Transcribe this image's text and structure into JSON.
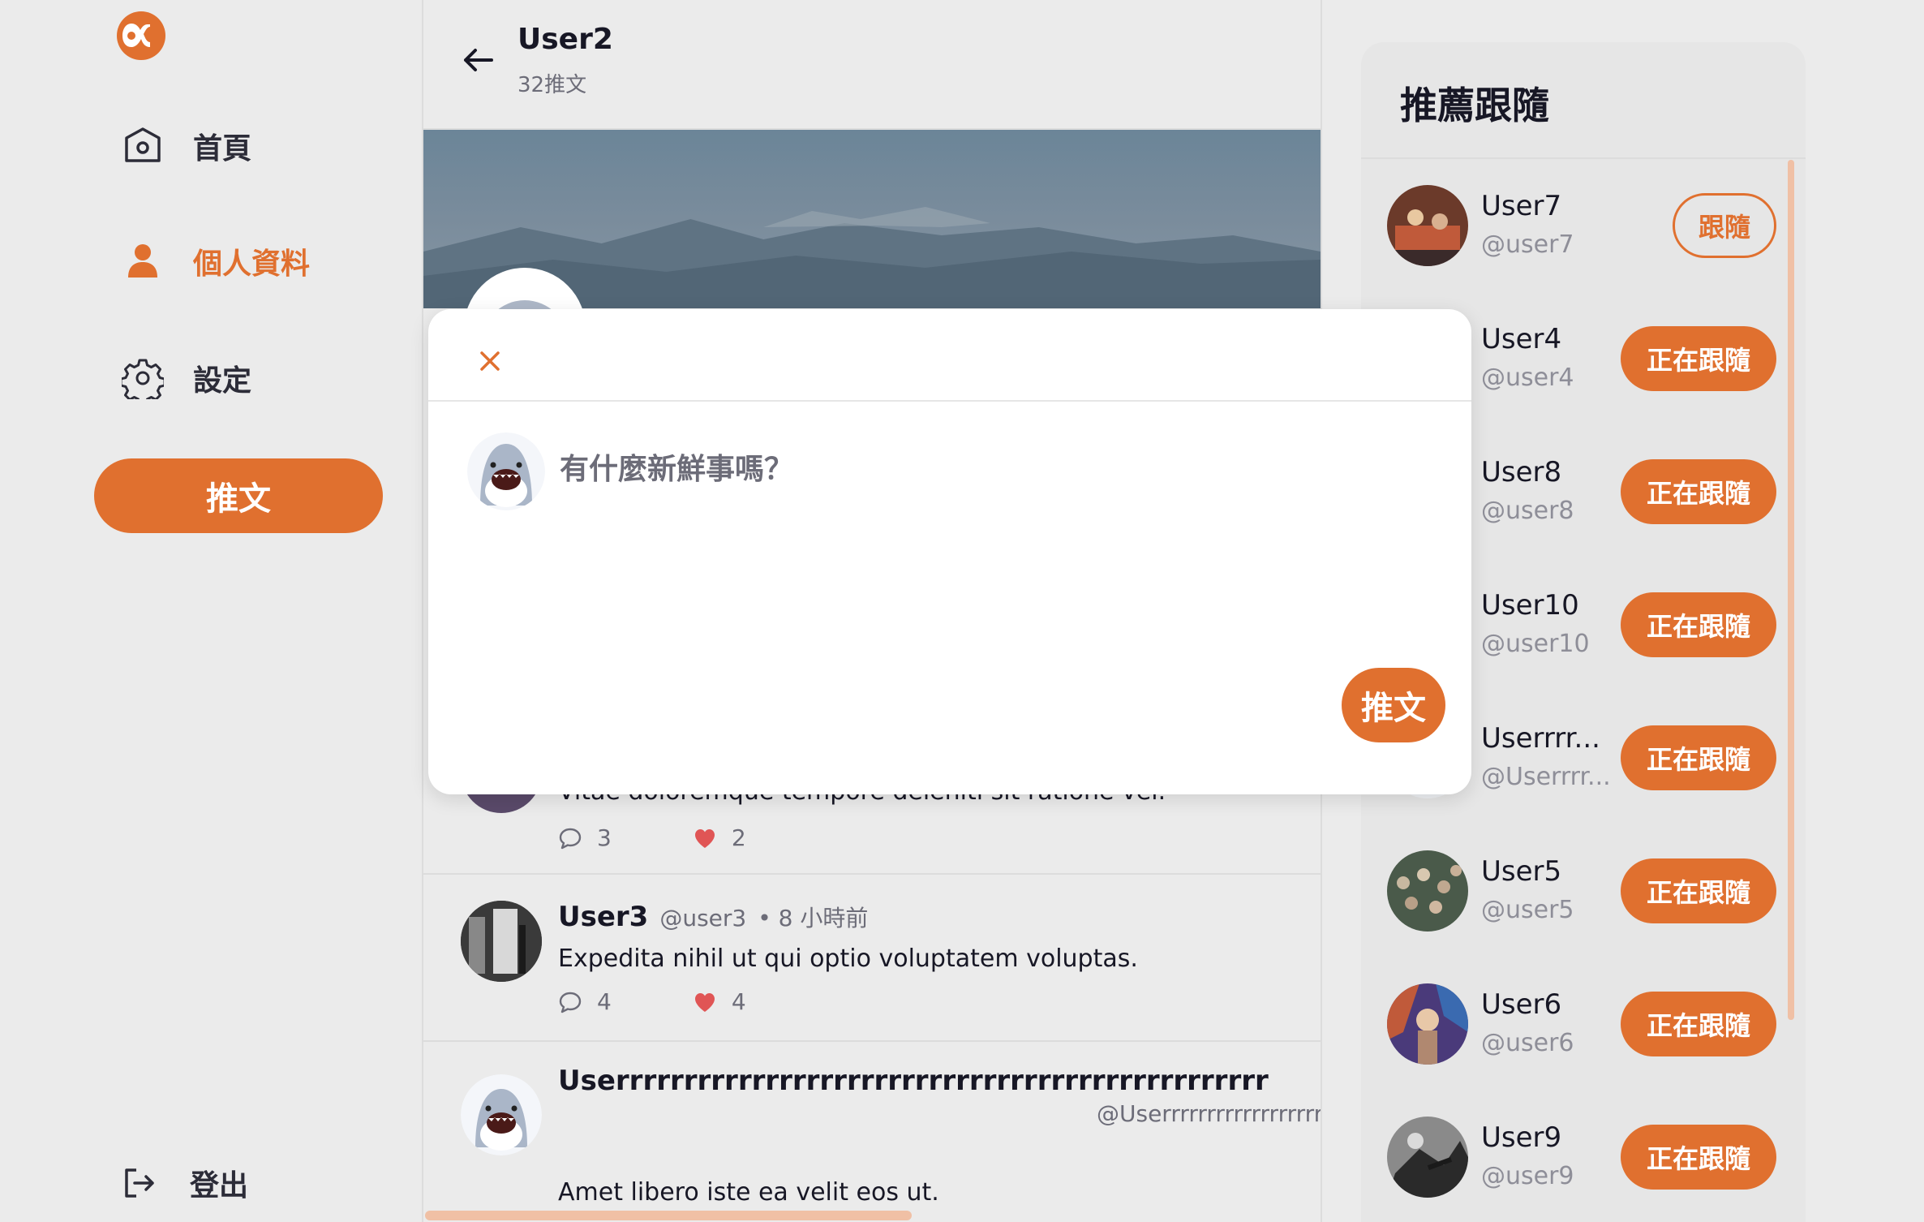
{
  "nav": {
    "logo": "alpha-logo-icon",
    "items": [
      {
        "label": "首頁",
        "icon": "home-icon"
      },
      {
        "label": "個人資料",
        "icon": "user-icon",
        "active": true
      },
      {
        "label": "設定",
        "icon": "gear-icon"
      }
    ],
    "tweet_button": "推文",
    "logout": "登出"
  },
  "profile": {
    "name": "User2",
    "tweet_count": "32推文"
  },
  "tweets": [
    {
      "text": "Vitae doloremque tempore deleniti sit ratione vel.",
      "replies": "3",
      "likes": "2"
    },
    {
      "name": "User3",
      "handle": "@user3",
      "time": "• 8 小時前",
      "text": "Expedita nihil ut qui optio voluptatem voluptas.",
      "replies": "4",
      "likes": "4"
    },
    {
      "name": "Userrrrrrrrrrrrrrrrrrrrrrrrrrrrrrrrrrrrrrrrrrrrrrrr",
      "handle": "@Userrrrrrrrrrrrrrrrrrr",
      "text": "Amet libero iste ea velit eos ut."
    }
  ],
  "recommend": {
    "title": "推薦跟隨",
    "users": [
      {
        "name": "User7",
        "handle": "@user7",
        "button": "跟隨",
        "following": false
      },
      {
        "name": "User4",
        "handle": "@user4",
        "button": "正在跟隨",
        "following": true
      },
      {
        "name": "User8",
        "handle": "@user8",
        "button": "正在跟隨",
        "following": true
      },
      {
        "name": "User10",
        "handle": "@user10",
        "button": "正在跟隨",
        "following": true
      },
      {
        "name": "Userrrr...",
        "handle": "@Userrrr...",
        "button": "正在跟隨",
        "following": true
      },
      {
        "name": "User5",
        "handle": "@user5",
        "button": "正在跟隨",
        "following": true
      },
      {
        "name": "User6",
        "handle": "@user6",
        "button": "正在跟隨",
        "following": true
      },
      {
        "name": "User9",
        "handle": "@user9",
        "button": "正在跟隨",
        "following": true
      }
    ]
  },
  "modal": {
    "placeholder": "有什麼新鮮事嗎？",
    "submit": "推文"
  },
  "colors": {
    "accent": "#e0702f",
    "background": "#ebebeb",
    "like": "#e05555"
  }
}
